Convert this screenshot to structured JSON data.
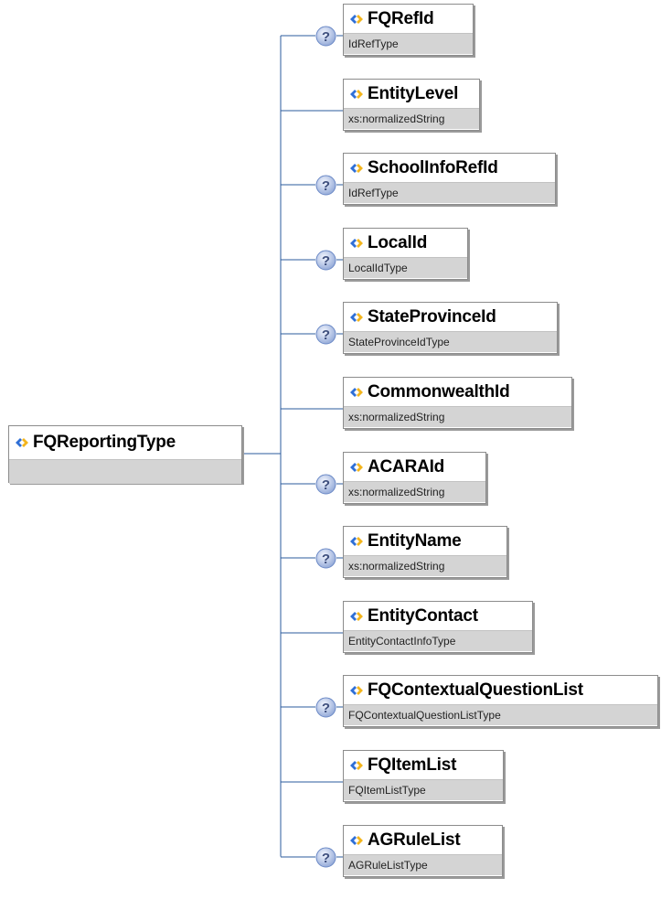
{
  "root": {
    "name": "FQReportingType",
    "type": ""
  },
  "children": [
    {
      "name": "FQRefId",
      "type": "IdRefType",
      "optional": true
    },
    {
      "name": "EntityLevel",
      "type": "xs:normalizedString",
      "optional": false
    },
    {
      "name": "SchoolInfoRefId",
      "type": "IdRefType",
      "optional": true
    },
    {
      "name": "LocalId",
      "type": "LocalIdType",
      "optional": true
    },
    {
      "name": "StateProvinceId",
      "type": "StateProvinceIdType",
      "optional": true
    },
    {
      "name": "CommonwealthId",
      "type": "xs:normalizedString",
      "optional": false
    },
    {
      "name": "ACARAId",
      "type": "xs:normalizedString",
      "optional": true
    },
    {
      "name": "EntityName",
      "type": "xs:normalizedString",
      "optional": true
    },
    {
      "name": "EntityContact",
      "type": "EntityContactInfoType",
      "optional": false
    },
    {
      "name": "FQContextualQuestionList",
      "type": "FQContextualQuestionListType",
      "optional": true
    },
    {
      "name": "FQItemList",
      "type": "FQItemListType",
      "optional": false
    },
    {
      "name": "AGRuleList",
      "type": "AGRuleListType",
      "optional": true
    }
  ],
  "colors": {
    "connector": "#2b5b9c",
    "optional_badge": "#6b89c6",
    "type_bar": "#d4d4d4"
  },
  "icons": {
    "element": "element-diamond-icon",
    "optional": "optional-question-icon"
  }
}
